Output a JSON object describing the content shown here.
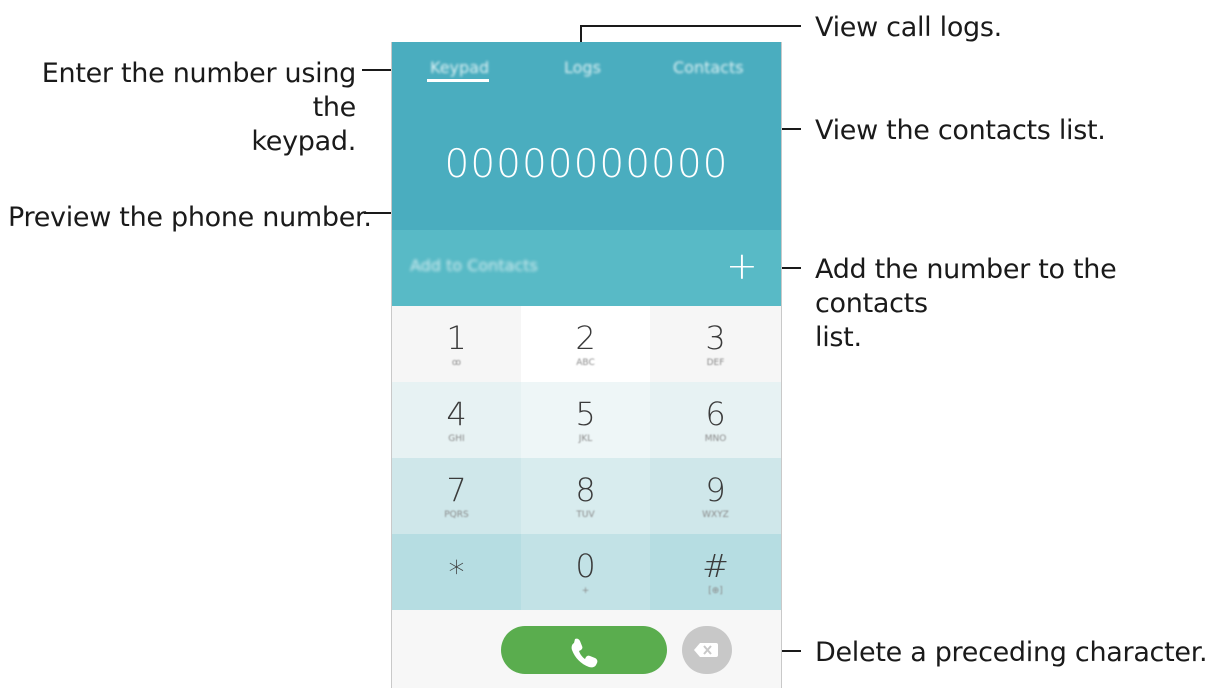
{
  "callouts": {
    "enter_number": "Enter the number using the keypad.",
    "enter_number_line1": "Enter the number using the",
    "enter_number_line2": "keypad.",
    "view_logs": "View call logs.",
    "view_contacts": "View the contacts list.",
    "preview": "Preview the phone number.",
    "add_number_line1": "Add the number to the contacts",
    "add_number_line2": "list.",
    "delete": "Delete a preceding character."
  },
  "tabs": [
    {
      "label": "Keypad",
      "active": true
    },
    {
      "label": "Logs",
      "active": false
    },
    {
      "label": "Contacts",
      "active": false
    }
  ],
  "phone_number": "00000000000",
  "add_to_contacts": {
    "label": "Add to Contacts",
    "icon": "plus-icon"
  },
  "keypad": [
    {
      "digit": "1",
      "sub": "ꝏ",
      "sub_icon": "voicemail-icon"
    },
    {
      "digit": "2",
      "sub": "ABC"
    },
    {
      "digit": "3",
      "sub": "DEF"
    },
    {
      "digit": "4",
      "sub": "GHI"
    },
    {
      "digit": "5",
      "sub": "JKL"
    },
    {
      "digit": "6",
      "sub": "MNO"
    },
    {
      "digit": "7",
      "sub": "PQRS"
    },
    {
      "digit": "8",
      "sub": "TUV"
    },
    {
      "digit": "9",
      "sub": "WXYZ"
    },
    {
      "digit": "∗",
      "sub": ""
    },
    {
      "digit": "0",
      "sub": "+"
    },
    {
      "digit": "#",
      "sub": "[⊕]"
    }
  ],
  "colors": {
    "header": "#4aadbf",
    "add_bar": "#58bac6",
    "call_button": "#5aad4e",
    "delete_button": "#c8c8c8",
    "keypad_row1": "#f6f6f6",
    "keypad_row2": "#e7f2f3",
    "keypad_row3": "#cfe7ea",
    "keypad_row4": "#b6dde2"
  },
  "icons": {
    "call": "phone-handset-icon",
    "delete": "backspace-icon"
  }
}
